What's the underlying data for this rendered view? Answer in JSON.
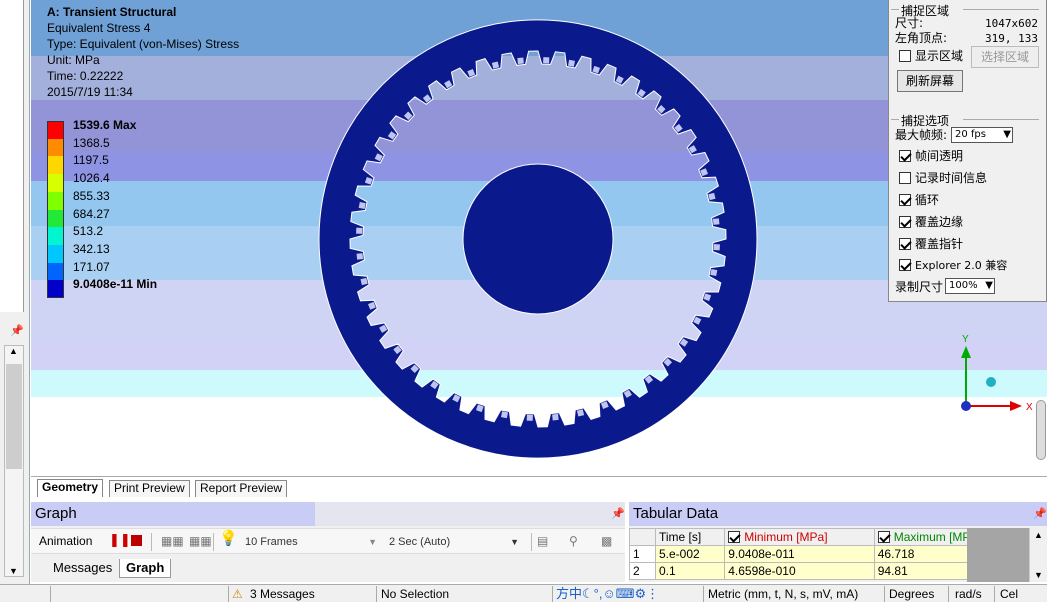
{
  "viewport": {
    "title": "A: Transient Structural",
    "result": "Equivalent Stress 4",
    "type": "Type: Equivalent (von-Mises) Stress",
    "unit": "Unit: MPa",
    "time": "Time: 0.22222",
    "date": "2015/7/19 11:34",
    "bands": [
      "#6fa0d6",
      "#a3b0dc",
      "#9294d7",
      "#8e93e4",
      "#93c7ef",
      "#a9d0f2",
      "#cfd3f4",
      "#d1d2f6",
      "#cdfafc",
      "#ffffff"
    ],
    "legend": [
      {
        "label": "1539.6 Max",
        "color": "#ff0000",
        "bold": true
      },
      {
        "label": "1368.5",
        "color": "#ff8c00"
      },
      {
        "label": "1197.5",
        "color": "#ffd700"
      },
      {
        "label": "1026.4",
        "color": "#d7ff00"
      },
      {
        "label": "855.33",
        "color": "#7fff00"
      },
      {
        "label": "684.27",
        "color": "#22e838"
      },
      {
        "label": "513.2",
        "color": "#00f5d0"
      },
      {
        "label": "342.13",
        "color": "#00c8ff"
      },
      {
        "label": "171.07",
        "color": "#0064ff"
      },
      {
        "label": "9.0408e-11 Min",
        "color": "#0000c8",
        "bold": true
      }
    ],
    "gear_color": "#0a1a8c",
    "triad": {
      "x": "X",
      "y": "Y"
    }
  },
  "tabs": [
    "Geometry",
    "Print Preview",
    "Report Preview"
  ],
  "graph": {
    "title": "Graph",
    "animation_label": "Animation",
    "frames": "10 Frames",
    "duration": "2 Sec (Auto)",
    "subtabs": [
      "Messages",
      "Graph"
    ]
  },
  "tabular": {
    "title": "Tabular Data",
    "headers": [
      "Time [s]",
      "Minimum [MPa]",
      "Maximum [MPa]"
    ],
    "rows": [
      {
        "idx": "1",
        "time": "5.e-002",
        "min": "9.0408e-011",
        "max": "46.718"
      },
      {
        "idx": "2",
        "time": "0.1",
        "min": "4.6598e-010",
        "max": "94.81"
      }
    ]
  },
  "status": {
    "messages": "3 Messages",
    "selection": "No Selection",
    "units": "Metric (mm, t, N, s, mV, mA)",
    "angle": "Degrees",
    "rot": "rad/s",
    "temp": "Cel"
  },
  "capture": {
    "region_group": "捕捉区域",
    "size_label": "尺寸:",
    "size_value": "1047x602",
    "corner_label": "左角顶点:",
    "corner_value": "319, 133",
    "show_region": "显示区域",
    "select_region": "选择区域",
    "refresh": "刷新屏幕",
    "options_group": "捕捉选项",
    "max_fps_label": "最大帧频:",
    "max_fps_value": "20 fps",
    "opt_transparent": "帧间透明",
    "opt_time": "记录时间信息",
    "opt_loop": "循环",
    "opt_edge": "覆盖边缘",
    "opt_cursor": "覆盖指针",
    "opt_explorer": "Explorer 2.0 兼容",
    "rec_size_label": "录制尺寸",
    "rec_size_value": "100%"
  }
}
